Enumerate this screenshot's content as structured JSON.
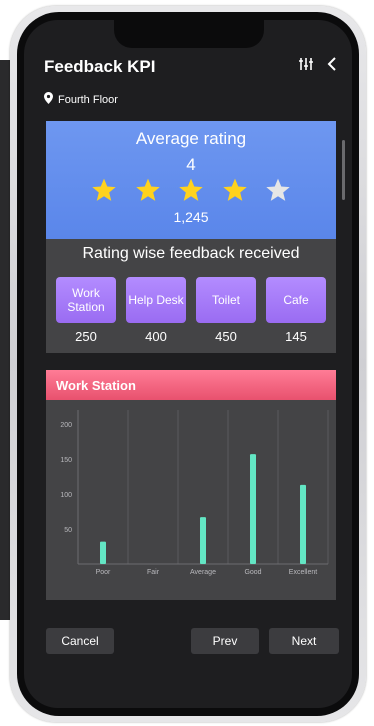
{
  "app": {
    "title": "Feedback KPI",
    "location": "Fourth Floor"
  },
  "header_icons": [
    "filter-sliders-icon",
    "back-chevron-icon",
    "location-pin-icon"
  ],
  "rating": {
    "title": "Average rating",
    "value": "4",
    "stars_filled": 4,
    "stars_total": 5,
    "count": "1,245"
  },
  "breakdown": {
    "title": "Rating wise feedback received",
    "categories": [
      {
        "label": "Work Station",
        "count": "250"
      },
      {
        "label": "Help Desk",
        "count": "400"
      },
      {
        "label": "Toilet",
        "count": "450"
      },
      {
        "label": "Cafe",
        "count": "145"
      }
    ]
  },
  "detail": {
    "title": "Work Station"
  },
  "chart_data": {
    "type": "bar",
    "categories": [
      "Poor",
      "Fair",
      "Average",
      "Good",
      "Excellent"
    ],
    "values": [
      32,
      0,
      67,
      157,
      113
    ],
    "yticks": [
      "50",
      "100",
      "150",
      "200"
    ],
    "ylim": [
      0,
      220
    ],
    "grid": true,
    "bar_color": "#63e6c4"
  },
  "footer": {
    "cancel": "Cancel",
    "prev": "Prev",
    "next": "Next"
  },
  "colors": {
    "rating_header": "#5a86ea",
    "category_button": "#9a6cf2",
    "detail_header": "#e8516e",
    "star_filled": "#ffd21e",
    "star_empty": "#e6e6e6"
  }
}
